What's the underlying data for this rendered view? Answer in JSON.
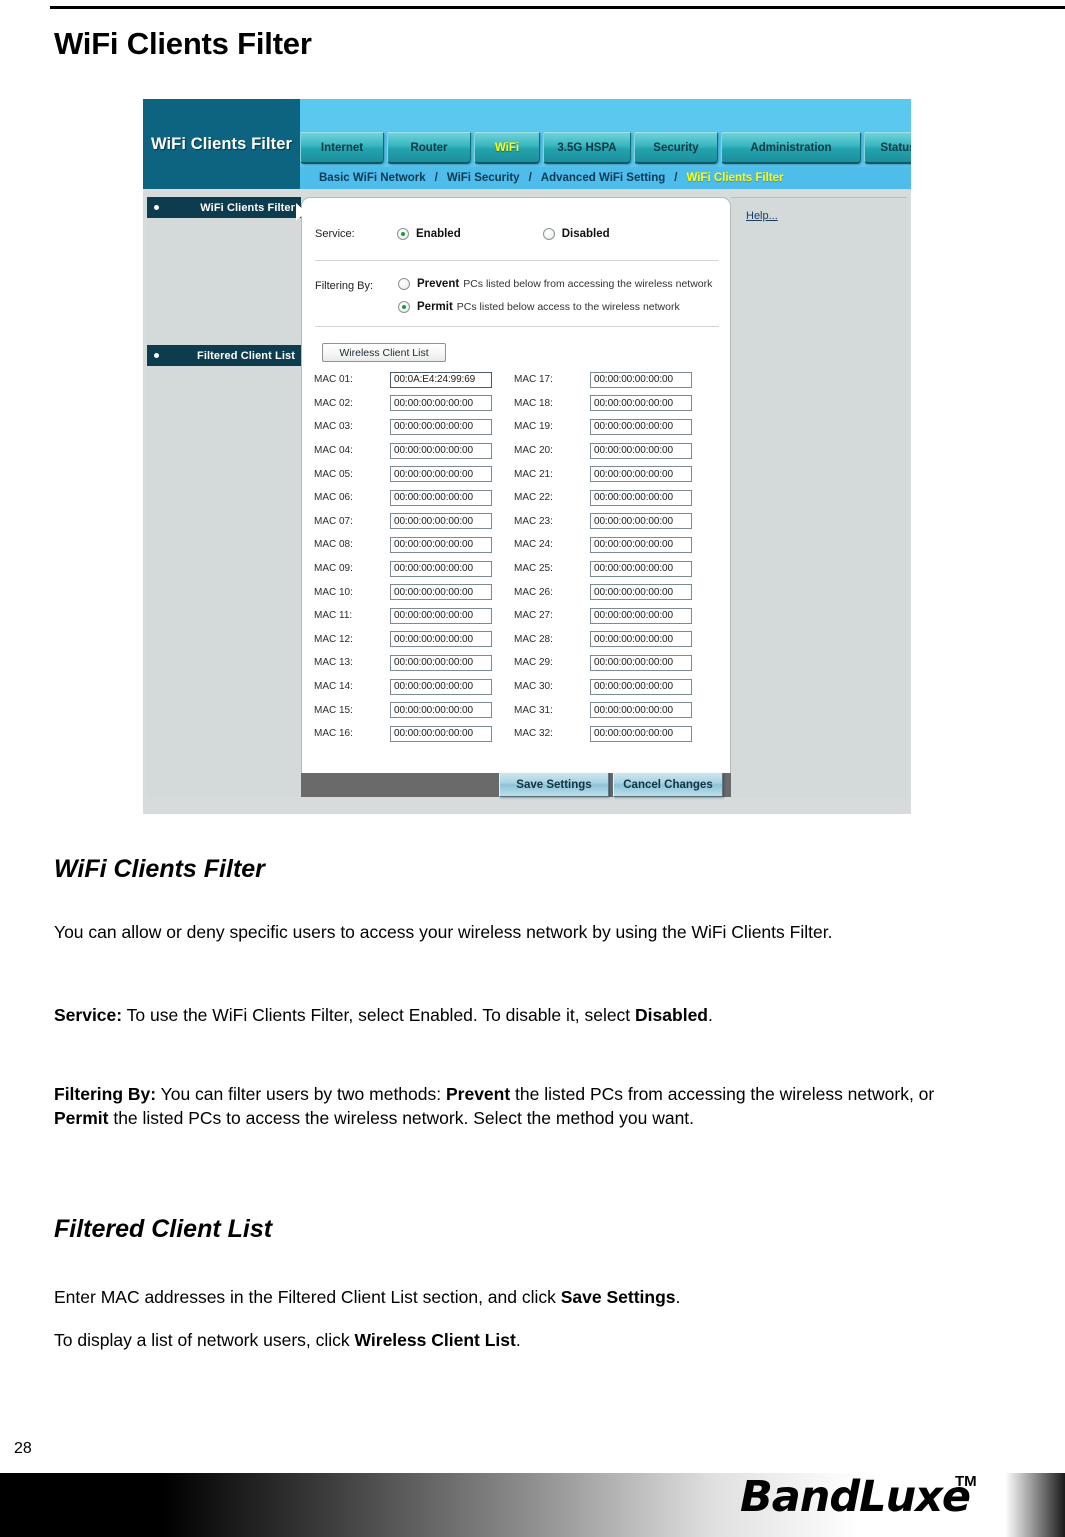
{
  "page": {
    "title": "WiFi Clients Filter",
    "number": "28"
  },
  "router_ui": {
    "brand_title": "WiFi Clients Filter",
    "tabs": [
      {
        "label": "Internet",
        "active": false
      },
      {
        "label": "Router",
        "active": false
      },
      {
        "label": "WiFi",
        "active": true
      },
      {
        "label": "3.5G HSPA",
        "active": false
      },
      {
        "label": "Security",
        "active": false
      },
      {
        "label": "Administration",
        "active": false
      },
      {
        "label": "Status",
        "active": false
      }
    ],
    "breadcrumbs": [
      {
        "label": "Basic WiFi Network",
        "current": false
      },
      {
        "label": "WiFi Security",
        "current": false
      },
      {
        "label": "Advanced WiFi Setting",
        "current": false
      },
      {
        "label": "WiFi Clients Filter",
        "current": true
      }
    ],
    "breadcrumb_separator": "/",
    "sidebar": [
      {
        "label": "WiFi Clients Filter"
      },
      {
        "label": "Filtered Client List"
      }
    ],
    "service": {
      "label": "Service:",
      "enabled_label": "Enabled",
      "disabled_label": "Disabled",
      "selected": "Enabled"
    },
    "filtering": {
      "label": "Filtering By:",
      "prevent_strong": "Prevent",
      "prevent_rest": "PCs listed below from accessing the wireless network",
      "permit_strong": "Permit",
      "permit_rest": "PCs listed below access to the wireless network",
      "selected": "Permit"
    },
    "wireless_client_list_button": "Wireless Client List",
    "mac_rows_left": [
      {
        "label": "MAC 01:",
        "value": "00:0A:E4:24:99:69",
        "filled": true
      },
      {
        "label": "MAC 02:",
        "value": "00:00:00:00:00:00",
        "filled": false
      },
      {
        "label": "MAC 03:",
        "value": "00:00:00:00:00:00",
        "filled": false
      },
      {
        "label": "MAC 04:",
        "value": "00:00:00:00:00:00",
        "filled": false
      },
      {
        "label": "MAC 05:",
        "value": "00:00:00:00:00:00",
        "filled": false
      },
      {
        "label": "MAC 06:",
        "value": "00:00:00:00:00:00",
        "filled": false
      },
      {
        "label": "MAC 07:",
        "value": "00:00:00:00:00:00",
        "filled": false
      },
      {
        "label": "MAC 08:",
        "value": "00:00:00:00:00:00",
        "filled": false
      },
      {
        "label": "MAC 09:",
        "value": "00:00:00:00:00:00",
        "filled": false
      },
      {
        "label": "MAC 10:",
        "value": "00:00:00:00:00:00",
        "filled": false
      },
      {
        "label": "MAC 11:",
        "value": "00:00:00:00:00:00",
        "filled": false
      },
      {
        "label": "MAC 12:",
        "value": "00:00:00:00:00:00",
        "filled": false
      },
      {
        "label": "MAC 13:",
        "value": "00:00:00:00:00:00",
        "filled": false
      },
      {
        "label": "MAC 14:",
        "value": "00:00:00:00:00:00",
        "filled": false
      },
      {
        "label": "MAC 15:",
        "value": "00:00:00:00:00:00",
        "filled": false
      },
      {
        "label": "MAC 16:",
        "value": "00:00:00:00:00:00",
        "filled": false
      }
    ],
    "mac_rows_right": [
      {
        "label": "MAC 17:",
        "value": "00:00:00:00:00:00",
        "filled": false
      },
      {
        "label": "MAC 18:",
        "value": "00:00:00:00:00:00",
        "filled": false
      },
      {
        "label": "MAC 19:",
        "value": "00:00:00:00:00:00",
        "filled": false
      },
      {
        "label": "MAC 20:",
        "value": "00:00:00:00:00:00",
        "filled": false
      },
      {
        "label": "MAC 21:",
        "value": "00:00:00:00:00:00",
        "filled": false
      },
      {
        "label": "MAC 22:",
        "value": "00:00:00:00:00:00",
        "filled": false
      },
      {
        "label": "MAC 23:",
        "value": "00:00:00:00:00:00",
        "filled": false
      },
      {
        "label": "MAC 24:",
        "value": "00:00:00:00:00:00",
        "filled": false
      },
      {
        "label": "MAC 25:",
        "value": "00:00:00:00:00:00",
        "filled": false
      },
      {
        "label": "MAC 26:",
        "value": "00:00:00:00:00:00",
        "filled": false
      },
      {
        "label": "MAC 27:",
        "value": "00:00:00:00:00:00",
        "filled": false
      },
      {
        "label": "MAC 28:",
        "value": "00:00:00:00:00:00",
        "filled": false
      },
      {
        "label": "MAC 29:",
        "value": "00:00:00:00:00:00",
        "filled": false
      },
      {
        "label": "MAC 30:",
        "value": "00:00:00:00:00:00",
        "filled": false
      },
      {
        "label": "MAC 31:",
        "value": "00:00:00:00:00:00",
        "filled": false
      },
      {
        "label": "MAC 32:",
        "value": "00:00:00:00:00:00",
        "filled": false
      }
    ],
    "save_button": "Save Settings",
    "cancel_button": "Cancel Changes",
    "help_link": "Help...",
    "colors": {
      "brand_panel": "#0d6480",
      "nav_background": "#5bc8f0",
      "breadcrumb_bar": "#4ebdec",
      "tab_gradient_top": "#6fd3db",
      "tab_gradient_bottom": "#1d8f9c",
      "active_tab_text": "#ffff00",
      "sidebar_header": "#0d3c4e",
      "radio_dot": "#1a9c3c",
      "button_bar": "#6a6a6a"
    }
  },
  "sections": {
    "wifi_clients_filter_heading": "WiFi Clients Filter",
    "intro": "You can allow or deny specific users to access your wireless network by using the WiFi Clients Filter.",
    "service_lead": "Service:",
    "service_text_1": " To use the WiFi Clients Filter, select Enabled. To disable it, select ",
    "service_bold_2": "Disabled",
    "service_text_3": ".",
    "filtering_lead": "Filtering By:",
    "filtering_text_1": " You can filter users by two methods: ",
    "filtering_bold_2": "Prevent",
    "filtering_text_3": " the listed PCs from accessing the wireless network, or ",
    "filtering_bold_4": "Permit",
    "filtering_text_5": " the listed PCs to access the wireless network. Select the method you want.",
    "filtered_client_list_heading": "Filtered Client List",
    "enter_text_1": "Enter MAC addresses in the Filtered Client List section, and click ",
    "enter_bold_2": "Save Settings",
    "enter_text_3": ".",
    "display_text_1": "To display a list of network users, click ",
    "display_bold_2": "Wireless Client List",
    "display_text_3": "."
  },
  "footer": {
    "logo_text": "BandLuxe",
    "trademark": "TM"
  }
}
